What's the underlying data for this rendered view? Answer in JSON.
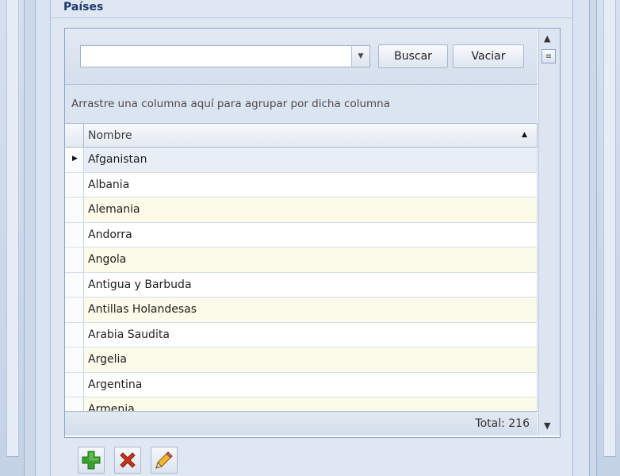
{
  "section": {
    "title": "Países"
  },
  "search": {
    "value": "",
    "search_button": "Buscar",
    "clear_button": "Vaciar"
  },
  "grid": {
    "group_hint": "Arrastre una columna aquí para agrupar por dicha columna",
    "column_header": "Nombre",
    "rows": [
      "Afganistan",
      "Albania",
      "Alemania",
      "Andorra",
      "Angola",
      "Antigua y Barbuda",
      "Antillas Holandesas",
      "Arabia Saudita",
      "Argelia",
      "Argentina",
      "Armenia"
    ],
    "total": "Total: 216"
  },
  "icons": {
    "add": "plus-icon",
    "delete": "x-icon",
    "edit": "pencil-icon",
    "sort": "sort-ascending-icon"
  },
  "colors": {
    "add_green": "#3aa12f",
    "delete_red": "#c9351b",
    "title_blue": "#1f3a6b",
    "alt_row": "#fcfae8"
  }
}
